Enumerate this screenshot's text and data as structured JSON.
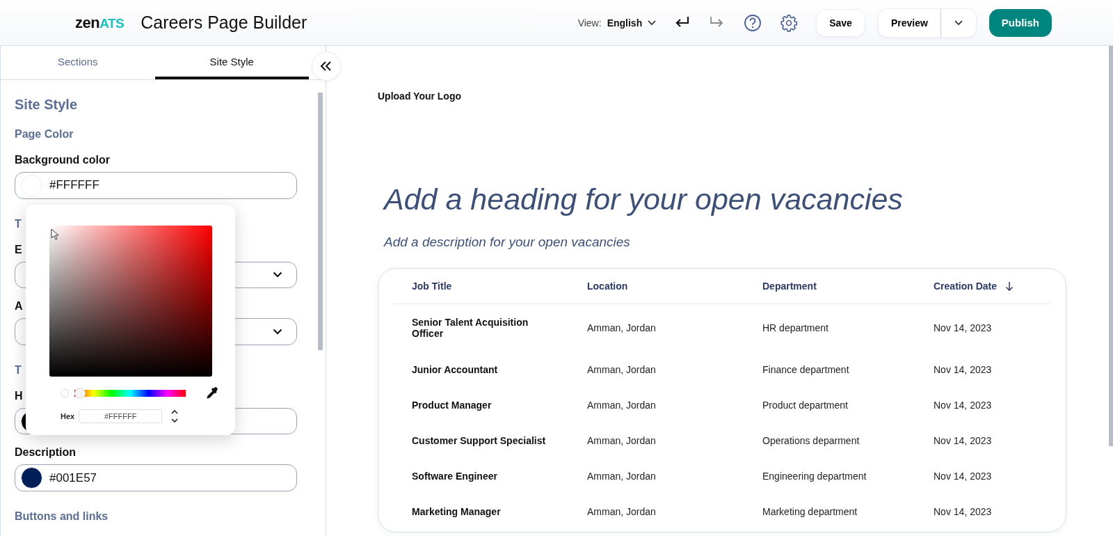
{
  "header": {
    "logo": {
      "part_1": "zen",
      "part_2": "ATS"
    },
    "title": "Careers Page Builder",
    "view": {
      "label": "View:",
      "value": "English"
    },
    "save": "Save",
    "preview": "Preview",
    "publish": "Publish"
  },
  "sidebar": {
    "tabs": [
      {
        "label": "Sections",
        "selected": false
      },
      {
        "label": "Site Style",
        "selected": true
      }
    ],
    "items": [
      {
        "kind": "heading",
        "text": "Site Style"
      },
      {
        "kind": "section",
        "text": "Page Color"
      },
      {
        "kind": "label",
        "text": "Background color"
      },
      {
        "kind": "color_field",
        "value": "#FFFFFF",
        "color": "#ffffff"
      },
      {
        "kind": "section",
        "text": "T"
      },
      {
        "kind": "label",
        "text": "E"
      },
      {
        "kind": "select_field"
      },
      {
        "kind": "label",
        "text": "A"
      },
      {
        "kind": "select_field"
      },
      {
        "kind": "section",
        "text": "T"
      },
      {
        "kind": "label",
        "text": "H"
      },
      {
        "kind": "color_field",
        "color": "#000000"
      },
      {
        "kind": "label",
        "text": "Description"
      },
      {
        "kind": "color_field",
        "value": "#001E57",
        "color": "#001e57"
      },
      {
        "kind": "section",
        "text": "Buttons and links"
      }
    ]
  },
  "color_picker": {
    "hue": {
      "level": 0
    },
    "hex_label": "Hex",
    "hex_value": "#FFFFFF"
  },
  "canvas": {
    "logo_placeholder": "Upload Your Logo",
    "heading": "Add a heading for your open vacancies",
    "description": "Add a description for your open vacancies",
    "table": {
      "columns": [
        {
          "label": "Job Title",
          "sorted": false
        },
        {
          "label": "Location",
          "sorted": false
        },
        {
          "label": "Department",
          "sorted": false
        },
        {
          "label": "Creation Date",
          "sorted": true
        }
      ],
      "rows": [
        [
          "Senior Talent Acquisition Officer",
          "Amman, Jordan",
          "HR department",
          "Nov 14, 2023"
        ],
        [
          "Junior Accountant",
          "Amman, Jordan",
          "Finance department",
          "Nov 14, 2023"
        ],
        [
          "Product Manager",
          "Amman, Jordan",
          "Product department",
          "Nov 14, 2023"
        ],
        [
          "Customer Support Specialist",
          "Amman, Jordan",
          "Operations deparment",
          "Nov 14, 2023"
        ],
        [
          "Software Engineer",
          "Amman, Jordan",
          "Engineering department",
          "Nov 14, 2023"
        ],
        [
          "Marketing Manager",
          "Amman, Jordan",
          "Marketing department",
          "Nov 14, 2023"
        ]
      ]
    }
  }
}
